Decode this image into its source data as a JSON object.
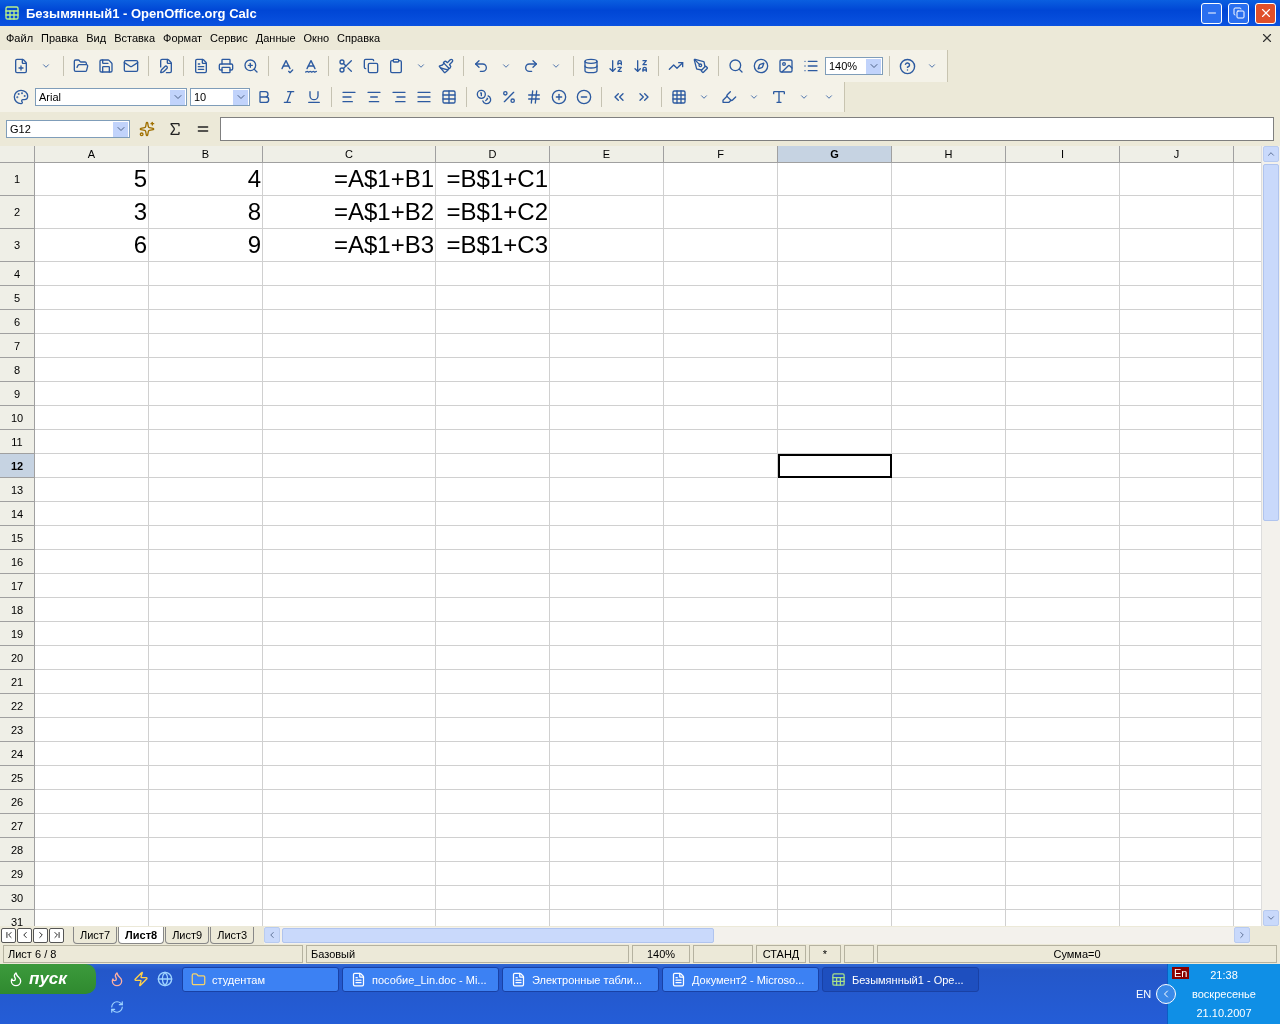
{
  "window": {
    "title": "Безымянный1 - OpenOffice.org Calc"
  },
  "menu": [
    "Файл",
    "Правка",
    "Вид",
    "Вставка",
    "Формат",
    "Сервис",
    "Данные",
    "Окно",
    "Справка"
  ],
  "formatting": {
    "font": "Arial",
    "size": "10",
    "zoom": "140%"
  },
  "formula_bar": {
    "name_box": "G12"
  },
  "columns": [
    {
      "label": "A",
      "selected": false
    },
    {
      "label": "B",
      "selected": false
    },
    {
      "label": "C",
      "selected": false
    },
    {
      "label": "D",
      "selected": false
    },
    {
      "label": "E",
      "selected": false
    },
    {
      "label": "F",
      "selected": false
    },
    {
      "label": "G",
      "selected": true
    },
    {
      "label": "H",
      "selected": false
    },
    {
      "label": "I",
      "selected": false
    },
    {
      "label": "J",
      "selected": false
    }
  ],
  "rows": [
    {
      "label": "1",
      "selected": false,
      "cells": [
        "5",
        "4",
        "=A$1+B1",
        "=B$1+C1"
      ]
    },
    {
      "label": "2",
      "selected": false,
      "cells": [
        "3",
        "8",
        "=A$1+B2",
        "=B$1+C2"
      ]
    },
    {
      "label": "3",
      "selected": false,
      "cells": [
        "6",
        "9",
        "=A$1+B3",
        "=B$1+C3"
      ]
    },
    {
      "label": "4",
      "selected": false
    },
    {
      "label": "5",
      "selected": false
    },
    {
      "label": "6",
      "selected": false
    },
    {
      "label": "7",
      "selected": false
    },
    {
      "label": "8",
      "selected": false
    },
    {
      "label": "9",
      "selected": false
    },
    {
      "label": "10",
      "selected": false
    },
    {
      "label": "11",
      "selected": false
    },
    {
      "label": "12",
      "selected": true
    },
    {
      "label": "13",
      "selected": false
    },
    {
      "label": "14",
      "selected": false
    },
    {
      "label": "15",
      "selected": false
    },
    {
      "label": "16",
      "selected": false
    },
    {
      "label": "17",
      "selected": false
    },
    {
      "label": "18",
      "selected": false
    },
    {
      "label": "19",
      "selected": false
    },
    {
      "label": "20",
      "selected": false
    },
    {
      "label": "21",
      "selected": false
    },
    {
      "label": "22",
      "selected": false
    },
    {
      "label": "23",
      "selected": false
    },
    {
      "label": "24",
      "selected": false
    },
    {
      "label": "25",
      "selected": false
    },
    {
      "label": "26",
      "selected": false
    },
    {
      "label": "27",
      "selected": false
    },
    {
      "label": "28",
      "selected": false
    },
    {
      "label": "29",
      "selected": false
    },
    {
      "label": "30",
      "selected": false
    },
    {
      "label": "31",
      "selected": false
    }
  ],
  "sheet_tabs": [
    {
      "label": "Лист7",
      "selected": false
    },
    {
      "label": "Лист8",
      "selected": true
    },
    {
      "label": "Лист9",
      "selected": false
    },
    {
      "label": "Лист3",
      "selected": false
    }
  ],
  "status_bar": {
    "sheet": "Лист 6 / 8",
    "style": "Базовый",
    "zoom": "140%",
    "mode": "СТАНД",
    "modified": "*",
    "sum": "Сумма=0"
  },
  "taskbar": {
    "start": "пуск",
    "tasks": [
      {
        "label": "студентам",
        "kind": "folder",
        "selected": false
      },
      {
        "label": "пособие_Lin.doc - Mi...",
        "kind": "word",
        "selected": false
      },
      {
        "label": "Электронные табли...",
        "kind": "word",
        "selected": false
      },
      {
        "label": "Документ2 - Microso...",
        "kind": "word",
        "selected": false
      },
      {
        "label": "Безымянный1 - Ope...",
        "kind": "calc",
        "selected": true
      }
    ],
    "tray": {
      "indicator": "En",
      "language": "EN",
      "time": "21:38",
      "day": "воскресенье",
      "date": "21.10.2007"
    }
  }
}
